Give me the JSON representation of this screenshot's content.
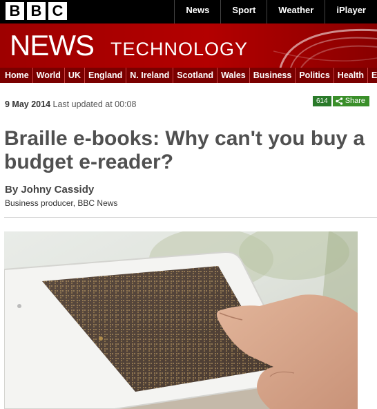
{
  "brand": {
    "logo_letters": [
      "B",
      "B",
      "C"
    ]
  },
  "top_nav": [
    "News",
    "Sport",
    "Weather",
    "iPlayer"
  ],
  "masthead": {
    "title": "NEWS",
    "section": "TECHNOLOGY"
  },
  "section_nav": [
    "Home",
    "World",
    "UK",
    "England",
    "N. Ireland",
    "Scotland",
    "Wales",
    "Business",
    "Politics",
    "Health",
    "Ed"
  ],
  "article": {
    "date": "9 May 2014",
    "updated": "Last updated at 00:08",
    "share_count": "614",
    "share_label": "Share",
    "headline": "Braille e-books: Why can't you buy a budget e-reader?",
    "author": "By Johny Cassidy",
    "author_role": "Business producer, BBC News"
  },
  "colors": {
    "bbc_red": "#b30000",
    "nav_red": "#7a0000",
    "share_green": "#3a8f2a"
  },
  "icons": {
    "share": "share-icon"
  }
}
